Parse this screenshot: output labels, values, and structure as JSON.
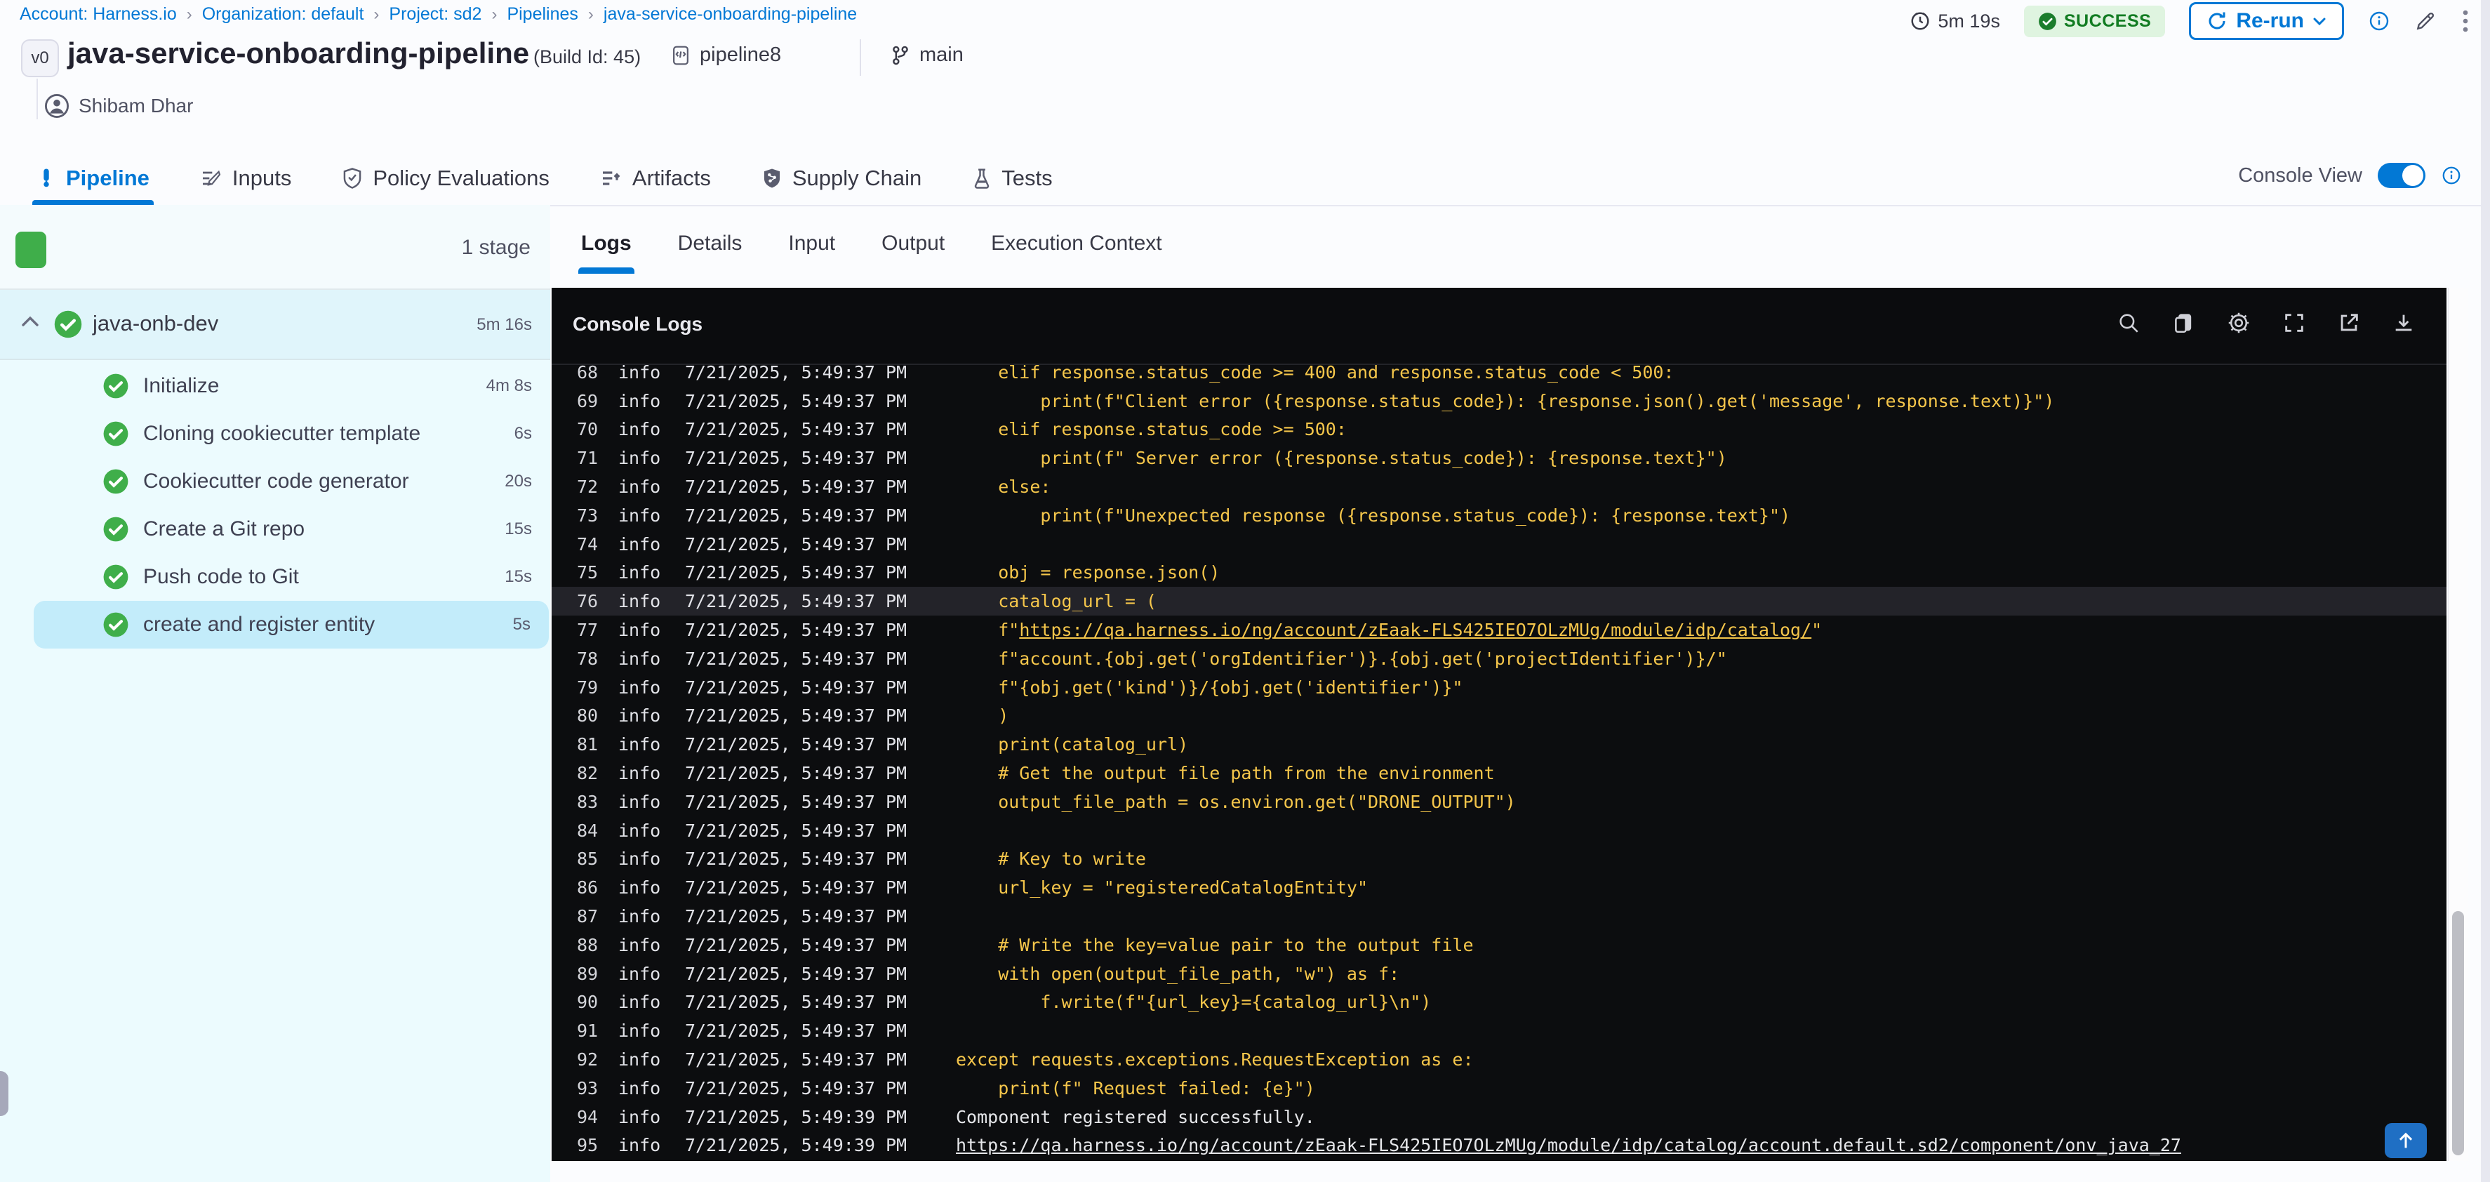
{
  "breadcrumb": {
    "separator": "›",
    "items": [
      "Account: Harness.io",
      "Organization: default",
      "Project: sd2",
      "Pipelines",
      "java-service-onboarding-pipeline"
    ]
  },
  "header": {
    "duration": "5m 19s",
    "status": "SUCCESS",
    "rerun_label": "Re-run",
    "version_badge": "v0",
    "title": "java-service-onboarding-pipeline",
    "build_id": "(Build Id: 45)",
    "pipeline_ref": "pipeline8",
    "branch": "main",
    "author": "Shibam Dhar"
  },
  "tabs": {
    "items": [
      {
        "label": "Pipeline",
        "active": true
      },
      {
        "label": "Inputs",
        "active": false
      },
      {
        "label": "Policy Evaluations",
        "active": false
      },
      {
        "label": "Artifacts",
        "active": false
      },
      {
        "label": "Supply Chain",
        "active": false
      },
      {
        "label": "Tests",
        "active": false
      }
    ],
    "console_view_label": "Console View",
    "console_view_on": true
  },
  "sidebar": {
    "stage_count_label": "1 stage",
    "stage": {
      "name": "java-onb-dev",
      "duration": "5m 16s"
    },
    "steps": [
      {
        "name": "Initialize",
        "duration": "4m 8s",
        "selected": false
      },
      {
        "name": "Cloning cookiecutter template",
        "duration": "6s",
        "selected": false
      },
      {
        "name": "Cookiecutter code generator",
        "duration": "20s",
        "selected": false
      },
      {
        "name": "Create a Git repo",
        "duration": "15s",
        "selected": false
      },
      {
        "name": "Push code to Git",
        "duration": "15s",
        "selected": false
      },
      {
        "name": "create and register entity",
        "duration": "5s",
        "selected": true
      }
    ]
  },
  "panel": {
    "tabs": [
      "Logs",
      "Details",
      "Input",
      "Output",
      "Execution Context"
    ],
    "active_tab": "Logs"
  },
  "console": {
    "title": "Console Logs",
    "toolbar_icons": [
      "search-icon",
      "copy-icon",
      "gear-icon",
      "fullscreen-icon",
      "external-link-icon",
      "download-icon"
    ],
    "lines": [
      {
        "n": "68",
        "level": "info",
        "time": "7/21/2025, 5:49:37 PM",
        "style": "code",
        "parts": [
          {
            "text": "    elif response.status_code >= 400 and response.status_code < 500:"
          }
        ]
      },
      {
        "n": "69",
        "level": "info",
        "time": "7/21/2025, 5:49:37 PM",
        "style": "code",
        "parts": [
          {
            "text": "        print(f\"Client error ({response.status_code}): {response.json().get('message', response.text)}\")"
          }
        ]
      },
      {
        "n": "70",
        "level": "info",
        "time": "7/21/2025, 5:49:37 PM",
        "style": "code",
        "parts": [
          {
            "text": "    elif response.status_code >= 500:"
          }
        ]
      },
      {
        "n": "71",
        "level": "info",
        "time": "7/21/2025, 5:49:37 PM",
        "style": "code",
        "parts": [
          {
            "text": "        print(f\" Server error ({response.status_code}): {response.text}\")"
          }
        ]
      },
      {
        "n": "72",
        "level": "info",
        "time": "7/21/2025, 5:49:37 PM",
        "style": "code",
        "parts": [
          {
            "text": "    else:"
          }
        ]
      },
      {
        "n": "73",
        "level": "info",
        "time": "7/21/2025, 5:49:37 PM",
        "style": "code",
        "parts": [
          {
            "text": "        print(f\"Unexpected response ({response.status_code}): {response.text}\")"
          }
        ]
      },
      {
        "n": "74",
        "level": "info",
        "time": "7/21/2025, 5:49:37 PM",
        "style": "code",
        "parts": [
          {
            "text": ""
          }
        ]
      },
      {
        "n": "75",
        "level": "info",
        "time": "7/21/2025, 5:49:37 PM",
        "style": "code",
        "parts": [
          {
            "text": "    obj = response.json()"
          }
        ]
      },
      {
        "n": "76",
        "level": "info",
        "time": "7/21/2025, 5:49:37 PM",
        "style": "code",
        "highlight": true,
        "parts": [
          {
            "text": "    catalog_url = ("
          }
        ]
      },
      {
        "n": "77",
        "level": "info",
        "time": "7/21/2025, 5:49:37 PM",
        "style": "code",
        "parts": [
          {
            "text": "    f\""
          },
          {
            "text": "https://qa.harness.io/ng/account/zEaak-FLS425IEO7OLzMUg/module/idp/catalog/",
            "underline": true
          },
          {
            "text": "\""
          }
        ]
      },
      {
        "n": "78",
        "level": "info",
        "time": "7/21/2025, 5:49:37 PM",
        "style": "code",
        "parts": [
          {
            "text": "    f\"account.{obj.get('orgIdentifier')}.{obj.get('projectIdentifier')}/\""
          }
        ]
      },
      {
        "n": "79",
        "level": "info",
        "time": "7/21/2025, 5:49:37 PM",
        "style": "code",
        "parts": [
          {
            "text": "    f\"{obj.get('kind')}/{obj.get('identifier')}\""
          }
        ]
      },
      {
        "n": "80",
        "level": "info",
        "time": "7/21/2025, 5:49:37 PM",
        "style": "code",
        "parts": [
          {
            "text": "    )"
          }
        ]
      },
      {
        "n": "81",
        "level": "info",
        "time": "7/21/2025, 5:49:37 PM",
        "style": "code",
        "parts": [
          {
            "text": "    print(catalog_url)"
          }
        ]
      },
      {
        "n": "82",
        "level": "info",
        "time": "7/21/2025, 5:49:37 PM",
        "style": "code",
        "parts": [
          {
            "text": "    # Get the output file path from the environment"
          }
        ]
      },
      {
        "n": "83",
        "level": "info",
        "time": "7/21/2025, 5:49:37 PM",
        "style": "code",
        "parts": [
          {
            "text": "    output_file_path = os.environ.get(\"DRONE_OUTPUT\")"
          }
        ]
      },
      {
        "n": "84",
        "level": "info",
        "time": "7/21/2025, 5:49:37 PM",
        "style": "code",
        "parts": [
          {
            "text": ""
          }
        ]
      },
      {
        "n": "85",
        "level": "info",
        "time": "7/21/2025, 5:49:37 PM",
        "style": "code",
        "parts": [
          {
            "text": "    # Key to write"
          }
        ]
      },
      {
        "n": "86",
        "level": "info",
        "time": "7/21/2025, 5:49:37 PM",
        "style": "code",
        "parts": [
          {
            "text": "    url_key = \"registeredCatalogEntity\""
          }
        ]
      },
      {
        "n": "87",
        "level": "info",
        "time": "7/21/2025, 5:49:37 PM",
        "style": "code",
        "parts": [
          {
            "text": ""
          }
        ]
      },
      {
        "n": "88",
        "level": "info",
        "time": "7/21/2025, 5:49:37 PM",
        "style": "code",
        "parts": [
          {
            "text": "    # Write the key=value pair to the output file"
          }
        ]
      },
      {
        "n": "89",
        "level": "info",
        "time": "7/21/2025, 5:49:37 PM",
        "style": "code",
        "parts": [
          {
            "text": "    with open(output_file_path, \"w\") as f:"
          }
        ]
      },
      {
        "n": "90",
        "level": "info",
        "time": "7/21/2025, 5:49:37 PM",
        "style": "code",
        "parts": [
          {
            "text": "        f.write(f\"{url_key}={catalog_url}\\n\")"
          }
        ]
      },
      {
        "n": "91",
        "level": "info",
        "time": "7/21/2025, 5:49:37 PM",
        "style": "code",
        "parts": [
          {
            "text": ""
          }
        ]
      },
      {
        "n": "92",
        "level": "info",
        "time": "7/21/2025, 5:49:37 PM",
        "style": "code",
        "parts": [
          {
            "text": "except requests.exceptions.RequestException as e:"
          }
        ]
      },
      {
        "n": "93",
        "level": "info",
        "time": "7/21/2025, 5:49:37 PM",
        "style": "code",
        "parts": [
          {
            "text": "    print(f\" Request failed: {e}\")"
          }
        ]
      },
      {
        "n": "94",
        "level": "info",
        "time": "7/21/2025, 5:49:39 PM",
        "style": "plain",
        "parts": [
          {
            "text": "Component registered successfully."
          }
        ]
      },
      {
        "n": "95",
        "level": "info",
        "time": "7/21/2025, 5:49:39 PM",
        "style": "plain",
        "parts": [
          {
            "text": "https://qa.harness.io/ng/account/zEaak-FLS425IEO7OLzMUg/module/idp/catalog/account.default.sd2/component/onv_java_27",
            "underline": true
          }
        ]
      }
    ]
  },
  "colors": {
    "accent_blue": "#0278d5",
    "success_green": "#3fae4a",
    "success_badge_bg": "#dff4e0",
    "log_yellow": "#f5c64b",
    "console_bg": "#0c0d0f",
    "sidebar_bg": "#ecfbfe",
    "selected_step_bg": "#c3ecfa"
  }
}
